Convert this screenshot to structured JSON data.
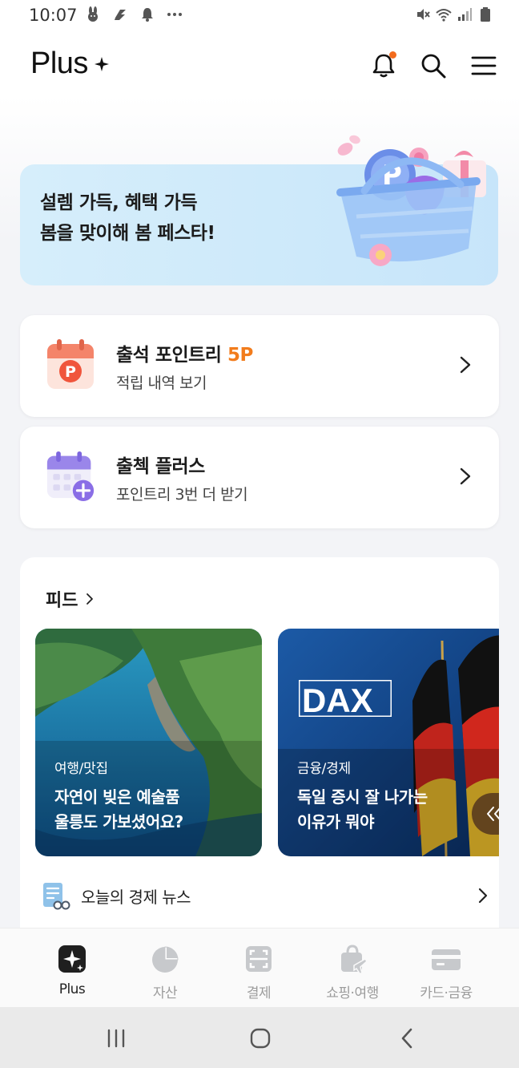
{
  "status_bar": {
    "time": "10:07",
    "left_icons": [
      "rabbit-icon",
      "s-app-icon",
      "notification-bell-icon",
      "more-dots-icon"
    ],
    "right_icons": [
      "mute-icon",
      "wifi-icon",
      "signal-icon",
      "battery-icon"
    ]
  },
  "header": {
    "title": "Plus",
    "has_unread_notification": true,
    "accent_color": "#f26b1d"
  },
  "banner": {
    "line1": "설렘 가득, 혜택 가득",
    "line2": "봄을 맞이해 봄 페스타!",
    "background": "#cfeafa"
  },
  "attendance_card": {
    "title": "출석 포인트리 ",
    "points": "5P",
    "subtitle": "적립 내역 보기"
  },
  "stamp_card": {
    "title": "출첵 플러스",
    "subtitle": "포인트리 3번 더 받기"
  },
  "feed": {
    "title": "피드",
    "items": [
      {
        "category": "여행/맛집",
        "headline_line1": "자연이 빚은 예술품",
        "headline_line2": "울릉도 가보셨어요?"
      },
      {
        "category": "금융/경제",
        "brand": "DAX",
        "headline_line1": "독일 증시 잘 나가는",
        "headline_line2": "이유가 뭐야"
      }
    ],
    "news_label": "오늘의 경제 뉴스"
  },
  "bottom_nav": {
    "items": [
      {
        "label": "Plus",
        "icon": "plus-sparkle-icon",
        "active": true
      },
      {
        "label": "자산",
        "icon": "pie-chart-icon",
        "active": false
      },
      {
        "label": "결제",
        "icon": "scan-pay-icon",
        "active": false
      },
      {
        "label": "쇼핑·여행",
        "icon": "shopping-bag-plane-icon",
        "active": false
      },
      {
        "label": "카드·금융",
        "icon": "credit-card-icon",
        "active": false
      }
    ]
  },
  "system_nav": [
    "recent-apps-icon",
    "home-icon",
    "back-icon"
  ]
}
